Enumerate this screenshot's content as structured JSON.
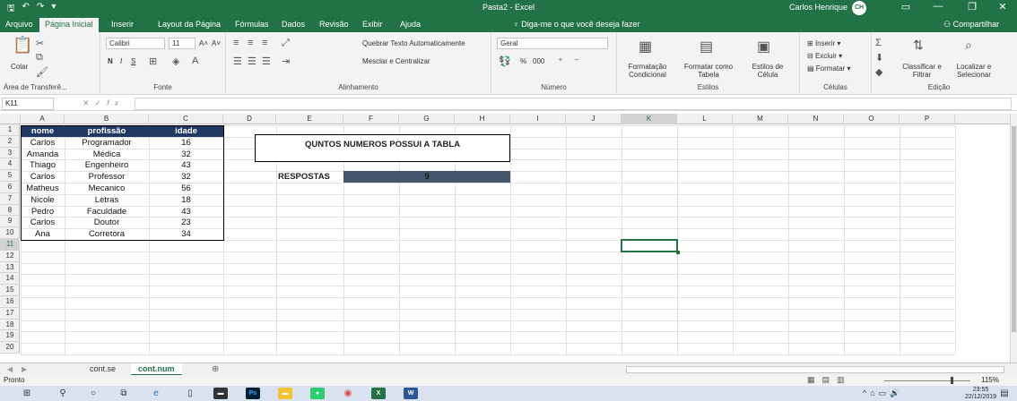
{
  "title_bar": {
    "title": "Pasta2 - Excel",
    "user": "Carlos Henrique",
    "initials": "CH"
  },
  "ribbon_tabs": [
    "Arquivo",
    "Página Inicial",
    "Inserir",
    "Layout da Página",
    "Fórmulas",
    "Dados",
    "Revisão",
    "Exibir",
    "Ajuda"
  ],
  "search_placeholder": "Diga-me o que você deseja fazer",
  "share_label": "Compartilhar",
  "ribbon": {
    "clipboard": {
      "paste": "Colar",
      "label": "Área de Transferê..."
    },
    "font": {
      "name": "Calibri",
      "size": "11",
      "bold": "N",
      "italic": "I",
      "underline": "S",
      "grow": "A˄",
      "shrink": "A˅",
      "label": "Fonte"
    },
    "alignment": {
      "wrap": "Quebrar Texto Automaticamente",
      "merge": "Mesclar e Centralizar",
      "label": "Alinhamento"
    },
    "number": {
      "format": "Geral",
      "percent": "%",
      "thousands": "000",
      "label": "Número"
    },
    "styles": {
      "conditional": "Formatação Condicional",
      "as_table": "Formatar como Tabela",
      "cell_styles": "Estilos de Célula",
      "label": "Estilos"
    },
    "cells": {
      "insert": "Inserir",
      "delete": "Excluir",
      "format": "Formatar",
      "label": "Células"
    },
    "editing": {
      "sort": "Classificar e Filtrar",
      "find": "Localizar e Selecionar",
      "label": "Edição"
    }
  },
  "formula_bar": {
    "name_box": "K11",
    "fx": "fx",
    "formula": ""
  },
  "columns": [
    "A",
    "B",
    "C",
    "D",
    "E",
    "F",
    "G",
    "H",
    "I",
    "J",
    "K",
    "L",
    "M",
    "N",
    "O",
    "P"
  ],
  "rows": [
    "1",
    "2",
    "3",
    "4",
    "5",
    "6",
    "7",
    "8",
    "9",
    "10",
    "11",
    "12",
    "13",
    "14",
    "15",
    "16",
    "17",
    "18",
    "19",
    "20"
  ],
  "table": {
    "headers": [
      "nome",
      "profissão",
      "idade"
    ],
    "rows": [
      [
        "Carlos",
        "Programador",
        "16"
      ],
      [
        "Amanda",
        "Médica",
        "32"
      ],
      [
        "Thiago",
        "Engenheiro",
        "43"
      ],
      [
        "Carlos",
        "Professor",
        "32"
      ],
      [
        "Matheus",
        "Mecanico",
        "56"
      ],
      [
        "Nicole",
        "Letras",
        "18"
      ],
      [
        "Pedro",
        "Faculdade",
        "43"
      ],
      [
        "Carlos",
        "Doutor",
        "23"
      ],
      [
        "Ana",
        "Corretora",
        "34"
      ]
    ]
  },
  "question": "QUNTOS NUMEROS POSSUI A TABLA",
  "answer": {
    "label": "RESPOSTAS",
    "value": "9"
  },
  "selected_cell": "K11",
  "sheets": [
    "cont.se",
    "cont.num"
  ],
  "active_sheet": "cont.num",
  "status": {
    "ready": "Pronto",
    "zoom": "115%"
  },
  "clock": {
    "time": "23:55",
    "date": "22/12/2019"
  },
  "colors": {
    "excel_green": "#217346",
    "table_header": "#1f3864",
    "answer_fill": "#44546a"
  }
}
